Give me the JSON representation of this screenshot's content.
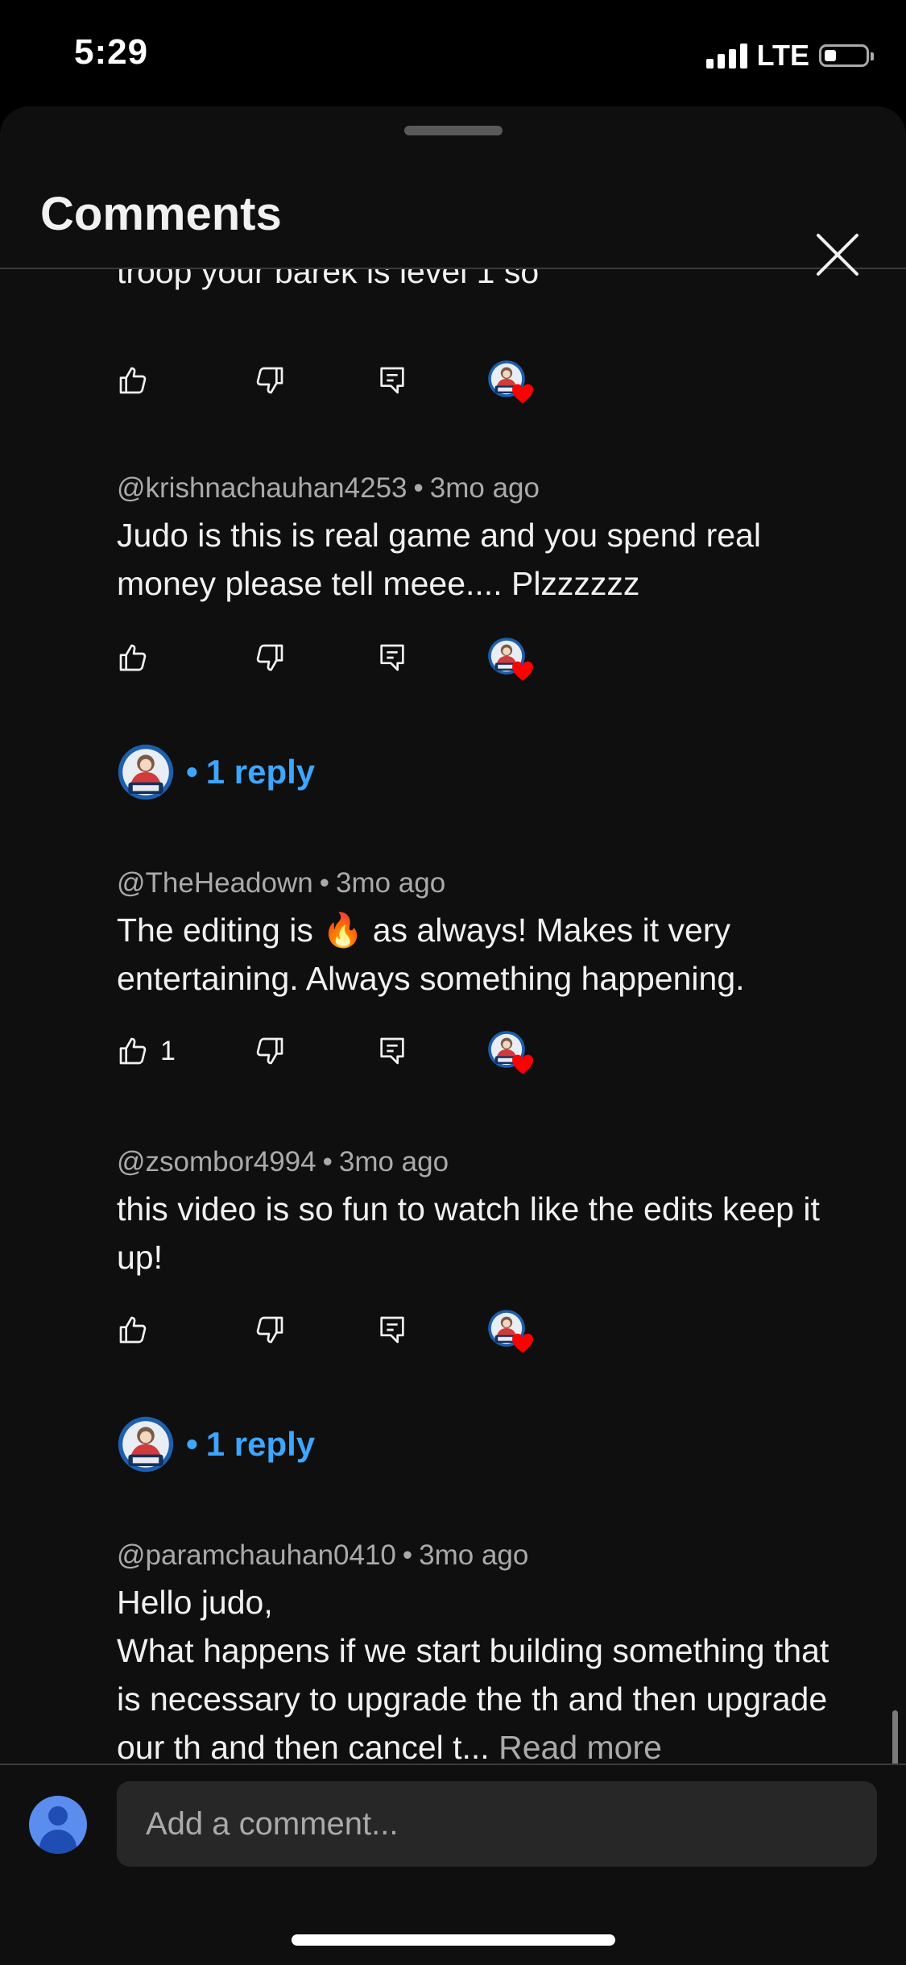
{
  "status_bar": {
    "time": "5:29",
    "network": "LTE"
  },
  "sheet": {
    "title": "Comments"
  },
  "comments": [
    {
      "text": "troop your barek is level 1 so",
      "likes": ""
    },
    {
      "author": "@krishnachauhan4253",
      "time": "3mo ago",
      "text": "Judo is this is real game and you spend real money please tell meee....  Plzzzzzz",
      "likes": ""
    },
    {
      "author": "@TheHeadown",
      "time": "3mo ago",
      "text_before": "The editing is ",
      "emoji": "🔥",
      "text_after": " as always! Makes it very entertaining. Always something happening.",
      "likes": "1"
    },
    {
      "author": "@zsombor4994",
      "time": "3mo ago",
      "text": "this video is so fun to watch like the edits keep it up!",
      "likes": ""
    },
    {
      "author": "@paramchauhan0410",
      "time": "3mo ago",
      "line1": "Hello judo,",
      "line2": "What happens if we start building something that is necessary to upgrade the th and then upgrade our th and then cancel t...",
      "read_more": "Read more"
    }
  ],
  "replies": [
    {
      "label": "1 reply",
      "dot": "•"
    },
    {
      "label": "1 reply",
      "dot": "•"
    }
  ],
  "composer": {
    "placeholder": "Add a comment..."
  },
  "colors": {
    "accent": "#3ea6ff",
    "heart": "#ff0000",
    "background": "#0f0f0f"
  },
  "icons": [
    "like-icon",
    "dislike-icon",
    "reply-icon",
    "creator-heart-icon",
    "close-icon",
    "user-avatar-icon"
  ]
}
